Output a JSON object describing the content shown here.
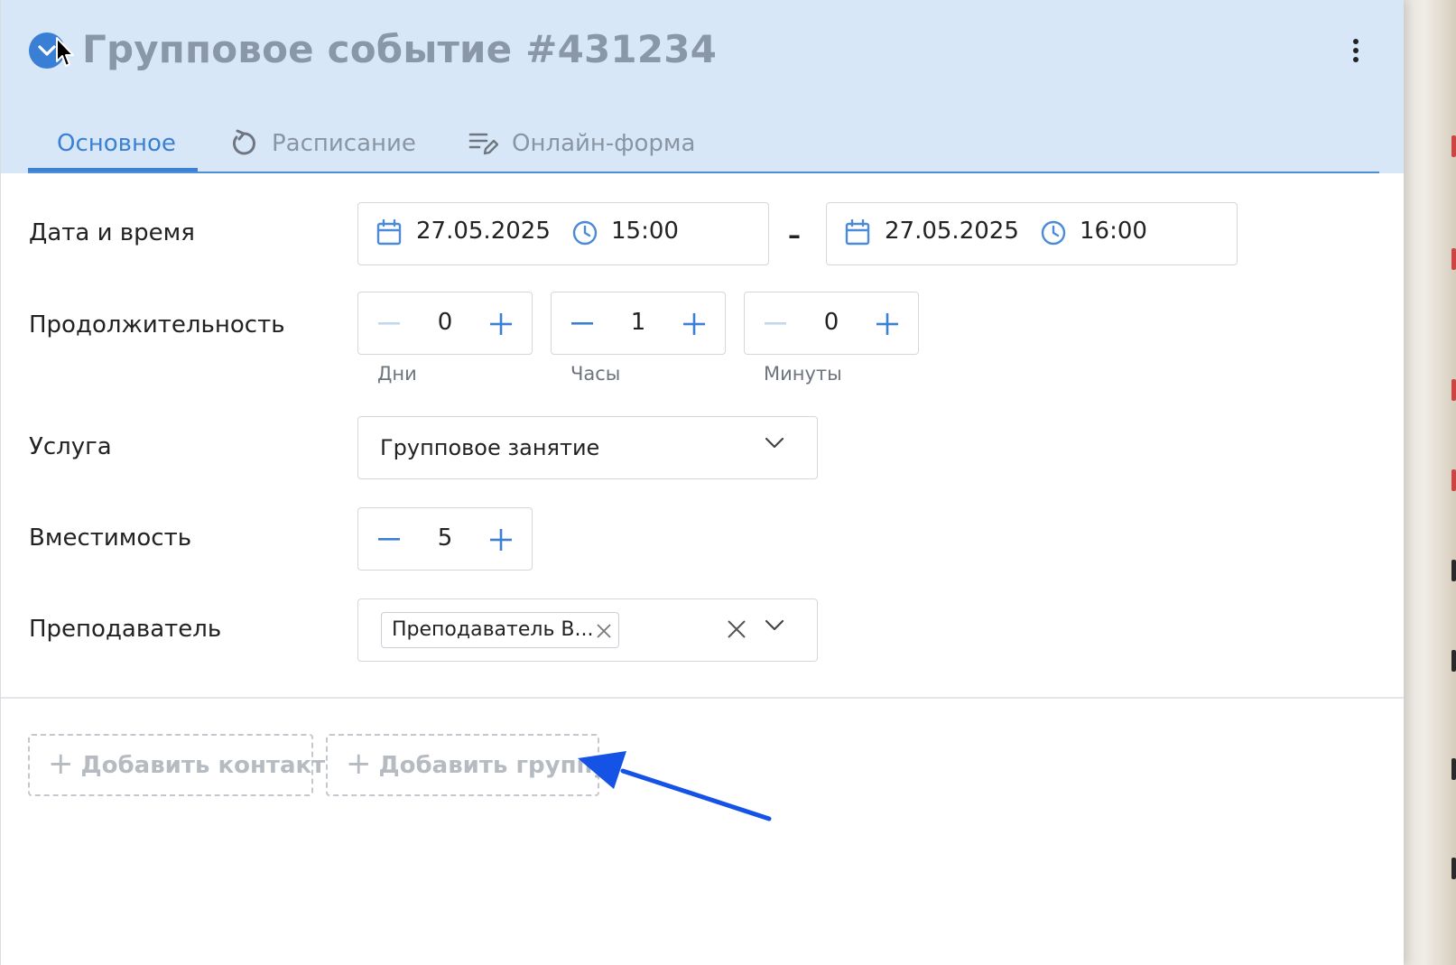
{
  "header": {
    "title": "Групповое событие #431234",
    "tabs": [
      {
        "label": "Основное",
        "icon": "",
        "active": true
      },
      {
        "label": "Расписание",
        "icon": "refresh-icon",
        "active": false
      },
      {
        "label": "Онлайн-форма",
        "icon": "form-edit-icon",
        "active": false
      }
    ]
  },
  "form": {
    "datetime": {
      "label": "Дата и время",
      "start_date": "27.05.2025",
      "start_time": "15:00",
      "separator": "–",
      "end_date": "27.05.2025",
      "end_time": "16:00"
    },
    "duration": {
      "label": "Продолжительность",
      "days": {
        "value": "0",
        "caption": "Дни"
      },
      "hours": {
        "value": "1",
        "caption": "Часы"
      },
      "minutes": {
        "value": "0",
        "caption": "Минуты"
      }
    },
    "service": {
      "label": "Услуга",
      "value": "Групповое занятие"
    },
    "capacity": {
      "label": "Вместимость",
      "value": "5"
    },
    "teacher": {
      "label": "Преподаватель",
      "chip": "Преподаватель В..."
    }
  },
  "actions": {
    "add_contact": "Добавить контакт",
    "add_group": "Добавить группу",
    "plus": "+"
  },
  "colors": {
    "accent": "#3a80d4",
    "header_bg": "#d8e7f7",
    "annotation_arrow": "#1552e6"
  }
}
